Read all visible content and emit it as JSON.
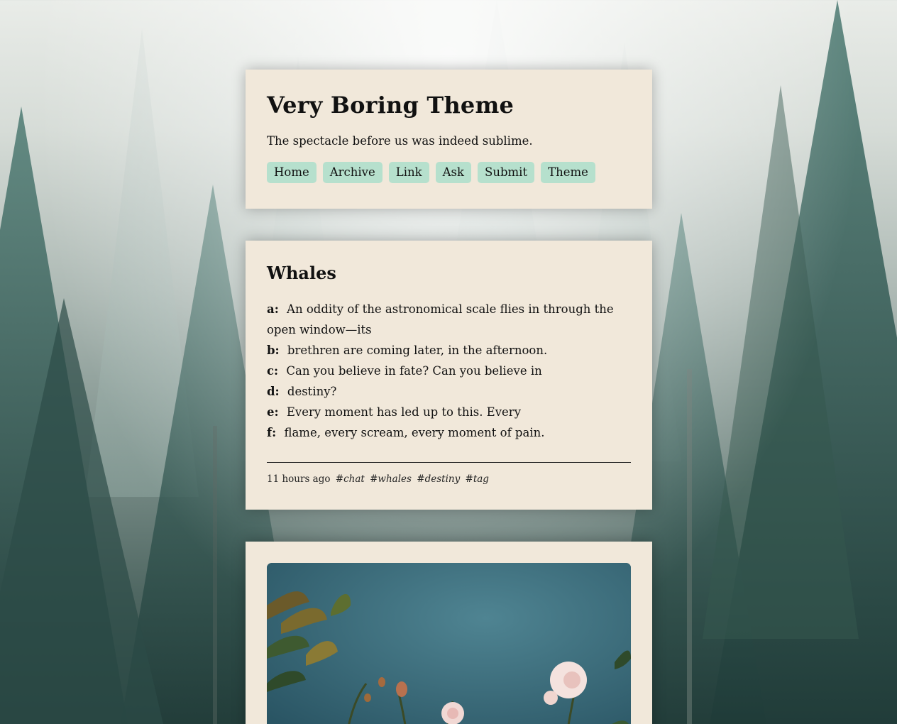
{
  "blog": {
    "title": "Very Boring Theme",
    "description": "The spectacle before us was indeed sublime.",
    "nav": [
      "Home",
      "Archive",
      "Link",
      "Ask",
      "Submit",
      "Theme"
    ]
  },
  "post_chat": {
    "title": "Whales",
    "lines": [
      {
        "label": "a:",
        "text": "An oddity of the astronomical scale flies in through the open window—its"
      },
      {
        "label": "b:",
        "text": "brethren are coming later, in the afternoon."
      },
      {
        "label": "c:",
        "text": "Can you believe in fate? Can you believe in"
      },
      {
        "label": "d:",
        "text": "destiny?"
      },
      {
        "label": "e:",
        "text": "Every moment has led up to this. Every"
      },
      {
        "label": "f:",
        "text": "flame, every scream, every moment of pain."
      }
    ],
    "time": "11 hours ago",
    "tags": [
      "#chat",
      "#whales",
      "#destiny",
      "#tag"
    ]
  },
  "post_photo": {
    "alt": ""
  },
  "colors": {
    "panel": "#f1e8da",
    "nav_bg": "#b6e0cd",
    "text": "#111111"
  }
}
